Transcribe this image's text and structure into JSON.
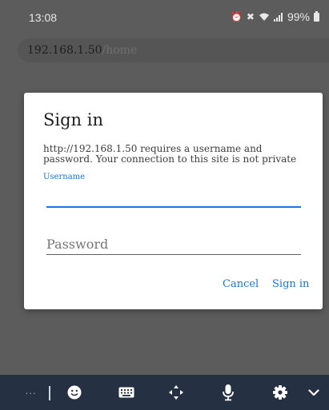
{
  "status_bar": {
    "time": "13:08",
    "battery": "99%"
  },
  "url_bar": {
    "host": "192.168.1.50",
    "path": "/home"
  },
  "dialog": {
    "title": "Sign in",
    "message": "http://192.168.1.50 requires a username and password. Your connection to this site is not private",
    "username_label": "Username",
    "username_value": "",
    "password_placeholder": "Password",
    "cancel_label": "Cancel",
    "signin_label": "Sign in"
  },
  "keyboard_toolbar": {
    "more": "···",
    "icons": [
      "more-icon",
      "emoji-icon",
      "keyboard-icon",
      "cursor-move-icon",
      "microphone-icon",
      "settings-icon",
      "collapse-icon"
    ]
  },
  "colors": {
    "accent": "#1a73e8",
    "toolbar": "#263043",
    "scrim": "#5c5c5c"
  }
}
